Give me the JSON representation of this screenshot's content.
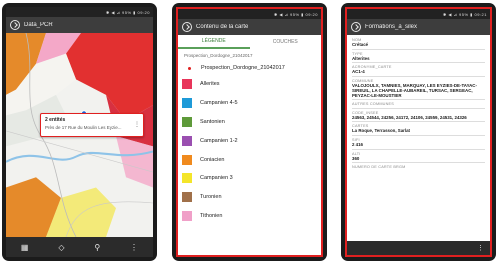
{
  "screen1": {
    "status": "✱ ◀ ⊿ 95% ▮ 09:20",
    "title": "Data_PCR",
    "popup": {
      "title": "2 entités",
      "subtitle": "Près de 17 Rue du Moulin Les Eyzie..."
    },
    "nav_icons": [
      "map-icon",
      "locate-icon",
      "search-icon",
      "overflow-icon"
    ]
  },
  "screen2": {
    "status": "✱ ◀ ⊿ 95% ▮ 09:20",
    "title": "Contenu de la carte",
    "tabs": [
      "LÉGENDE",
      "COUCHES"
    ],
    "layer_name": "Prospection_Dordogne_21042017",
    "point_label": "Prospection_Dordogne_21042017",
    "point_color": "#e02020",
    "items": [
      {
        "label": "Allerites",
        "color": "#e8355a"
      },
      {
        "label": "Campanien 4-5",
        "color": "#1e9ad8"
      },
      {
        "label": "Santonien",
        "color": "#5e9a3a"
      },
      {
        "label": "Campanien 1-2",
        "color": "#9a4fb0"
      },
      {
        "label": "Coniacien",
        "color": "#f08a1e"
      },
      {
        "label": "Campanien 3",
        "color": "#f4e52a"
      },
      {
        "label": "Turonien",
        "color": "#a0704a"
      },
      {
        "label": "Tithonien",
        "color": "#f0a0c8"
      }
    ]
  },
  "screen3": {
    "status": "✱ ◀ ⊿ 95% ▮ 09:21",
    "title": "Formations_à_silex",
    "fields": [
      {
        "k": "NOM",
        "v": "Crétacé"
      },
      {
        "k": "TYPE",
        "v": "Alterites"
      },
      {
        "k": "ACRONYME_CARTE",
        "v": "AC1-4"
      },
      {
        "k": "COMMUNE",
        "v": "VALOJOULX, TAMNIES, MARQUAY, LES EYZIES-DE-TAYAC-SIREUIL, LA CHAPELLE-AUBAREIL, TURSAC, SERGEAC, PEYZAC-LE-MOUSTIER"
      },
      {
        "k": "AUTRES COMMUNES",
        "v": ""
      },
      {
        "k": "CODE_INSEE",
        "v": "24563, 24544, 24256, 24172, 24106, 24559, 24531, 24326"
      },
      {
        "k": "CARTES",
        "v": "La Roque, Terrasson, Sarlat"
      },
      {
        "k": "SIFI",
        "v": "2 416"
      },
      {
        "k": "ALTI",
        "v": "360"
      },
      {
        "k": "NUMERO DE CARTE BRGM",
        "v": ""
      }
    ]
  }
}
